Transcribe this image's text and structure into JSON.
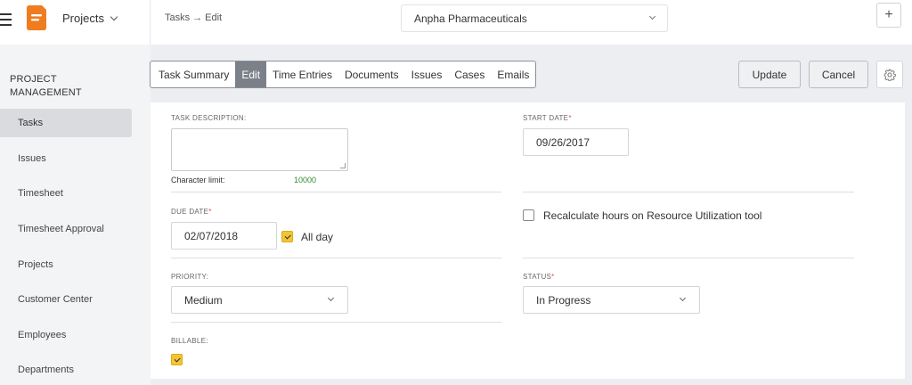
{
  "header": {
    "module_label": "Projects",
    "breadcrumb": {
      "parent": "Tasks",
      "arrow": "→",
      "current": "Edit"
    },
    "company": "Anpha Pharmaceuticals",
    "add_label": "+",
    "logo_color": "#f07c20"
  },
  "sidebar": {
    "title": "PROJECT MANAGEMENT",
    "items": [
      {
        "label": "Tasks",
        "active": true
      },
      {
        "label": "Issues"
      },
      {
        "label": "Timesheet"
      },
      {
        "label": "Timesheet Approval"
      },
      {
        "label": "Projects"
      },
      {
        "label": "Customer Center"
      },
      {
        "label": "Employees"
      },
      {
        "label": "Departments"
      }
    ]
  },
  "tabs": [
    {
      "label": "Task Summary"
    },
    {
      "label": "Edit",
      "active": true
    },
    {
      "label": "Time Entries"
    },
    {
      "label": "Documents"
    },
    {
      "label": "Issues"
    },
    {
      "label": "Cases"
    },
    {
      "label": "Emails"
    }
  ],
  "actions": {
    "update": "Update",
    "cancel": "Cancel"
  },
  "form": {
    "task_description": {
      "label": "TASK DESCRIPTION:",
      "value": ""
    },
    "char_limit": {
      "label": "Character limit:",
      "value": "10000"
    },
    "start_date": {
      "label": "START DATE",
      "required_mark": "*",
      "value": "09/26/2017"
    },
    "due_date": {
      "label": "DUE DATE",
      "required_mark": "*",
      "value": "02/07/2018"
    },
    "all_day": {
      "label": "All day",
      "checked": true
    },
    "recalculate": {
      "label": "Recalculate hours on Resource Utilization tool",
      "checked": false
    },
    "priority": {
      "label": "PRIORITY:",
      "value": "Medium"
    },
    "status": {
      "label": "STATUS",
      "required_mark": "*",
      "value": "In Progress"
    },
    "billable": {
      "label": "BILLABLE:",
      "checked": true
    }
  },
  "colors": {
    "accent_yellow": "#f2c533",
    "tab_active": "#7b8089",
    "sidebar_bg": "#f3f4f6",
    "required": "#d9534f",
    "char_limit_green": "#2e8b2e"
  }
}
